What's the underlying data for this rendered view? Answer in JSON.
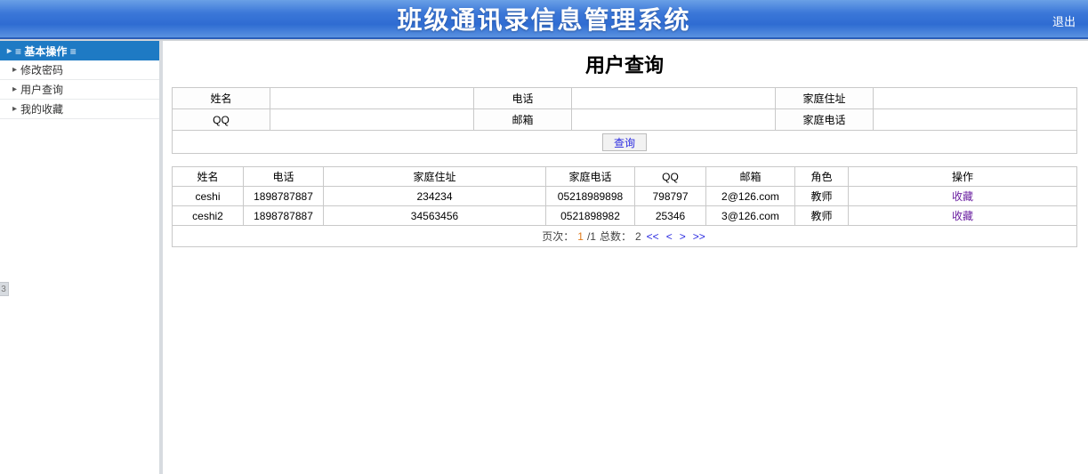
{
  "header": {
    "title": "班级通讯录信息管理系统",
    "logout": "退出"
  },
  "sidebar": {
    "group_label": "≡ 基本操作 ≡",
    "items": [
      {
        "label": "修改密码"
      },
      {
        "label": "用户查询"
      },
      {
        "label": "我的收藏"
      }
    ],
    "tab_marker": "3"
  },
  "main": {
    "title": "用户查询",
    "search": {
      "row1": {
        "c1": "姓名",
        "c2": "电话",
        "c3": "家庭住址"
      },
      "row2": {
        "c1": "QQ",
        "c2": "邮箱",
        "c3": "家庭电话"
      },
      "query_label": "查询",
      "values": {
        "name": "",
        "phone": "",
        "addr": "",
        "qq": "",
        "email": "",
        "homephone": ""
      }
    },
    "table": {
      "headers": [
        "姓名",
        "电话",
        "家庭住址",
        "家庭电话",
        "QQ",
        "邮箱",
        "角色",
        "操作"
      ],
      "rows": [
        {
          "c0": "ceshi",
          "c1": "1898787887",
          "c2": "234234",
          "c3": "05218989898",
          "c4": "798797",
          "c5": "2@126.com",
          "c6": "教师",
          "c7": "收藏"
        },
        {
          "c0": "ceshi2",
          "c1": "1898787887",
          "c2": "34563456",
          "c3": "0521898982",
          "c4": "25346",
          "c5": "3@126.com",
          "c6": "教师",
          "c7": "收藏"
        }
      ]
    },
    "pager": {
      "prefix": "页次：",
      "page": "1",
      "sep": "/1",
      "total_label": " 总数：",
      "total": "2",
      "nav_first": "<<",
      "nav_prev": "<",
      "nav_next": ">",
      "nav_last": ">>"
    }
  }
}
